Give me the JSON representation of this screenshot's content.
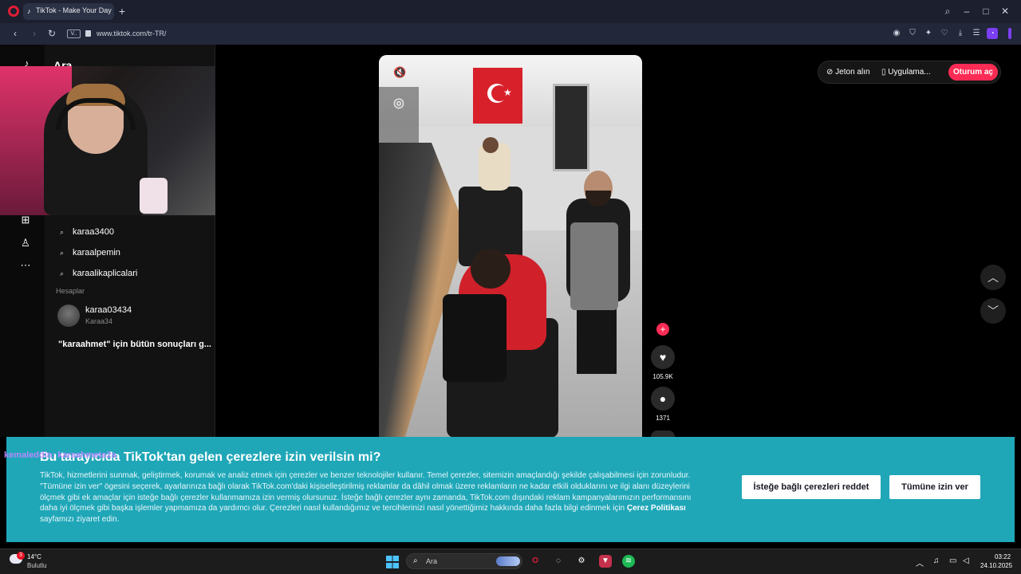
{
  "browser": {
    "tab_title": "TikTok - Make Your Day",
    "url": "www.tiktok.com/tr-TR/",
    "vpn_badge": "V..",
    "colors": {
      "accent": "#7b3ff2",
      "opera": "#e01e36"
    }
  },
  "search_panel": {
    "title": "Ara",
    "suggestions": [
      "karaa3400",
      "karaalpemin",
      "karaalikaplicalari"
    ],
    "accounts_label": "Hesaplar",
    "account": {
      "name": "karaa03434",
      "handle": "Karaa34"
    },
    "all_results": "\"karaahmet\" için bütün sonuçları g..."
  },
  "video": {
    "actions": {
      "likes": "105.9K",
      "comments": "1371"
    }
  },
  "topright": {
    "coins": "Jeton alın",
    "app": "Uygulama...",
    "login": "Oturum aç",
    "colors": {
      "brand": "#fe2c55"
    }
  },
  "cookie_banner": {
    "title": "Bu tarayıcıda TikTok'tan gelen çerezlere izin verilsin mi?",
    "body": "TikTok, hizmetlerini sunmak, geliştirmek, korumak ve analiz etmek için çerezler ve benzer teknolojiler kullanır. Temel çerezler, sitemizin amaçlandığı şekilde çalışabilmesi için zorunludur. \"Tümüne izin ver\" ögesini seçerek, ayarlarınıza bağlı olarak TikTok.com'daki kişiselleştirilmiş reklamlar da dâhil olmak üzere reklamların ne kadar etkili olduklarını ve ilgi alanı düzeylerini ölçmek gibi ek amaçlar için isteğe bağlı çerezler kullanmamıza izin vermiş olursunuz. İsteğe bağlı çerezler aynı zamanda, TikTok.com dışındaki reklam kampanyalarımızın performansını daha iyi ölçmek gibi başka işlemler yapmamıza da yardımcı olur. Çerezleri nasıl kullandığımız ve tercihlerinizi nasıl yönettiğimiz hakkında daha fazla bilgi edinmek için",
    "policy_link": "Çerez Politikası",
    "body_end": "sayfamızı ziyaret edin.",
    "reject": "İsteğe bağlı çerezleri reddet",
    "accept": "Tümüne izin ver",
    "color": "#1fa7b8"
  },
  "overlay": {
    "chat": "kemaleddin: karaahmete2a"
  },
  "taskbar": {
    "weather_temp": "14°C",
    "weather_desc": "Bulutlu",
    "weather_badge": "3",
    "search_placeholder": "Ara",
    "time": "03:22",
    "date": "24.10.2025"
  }
}
